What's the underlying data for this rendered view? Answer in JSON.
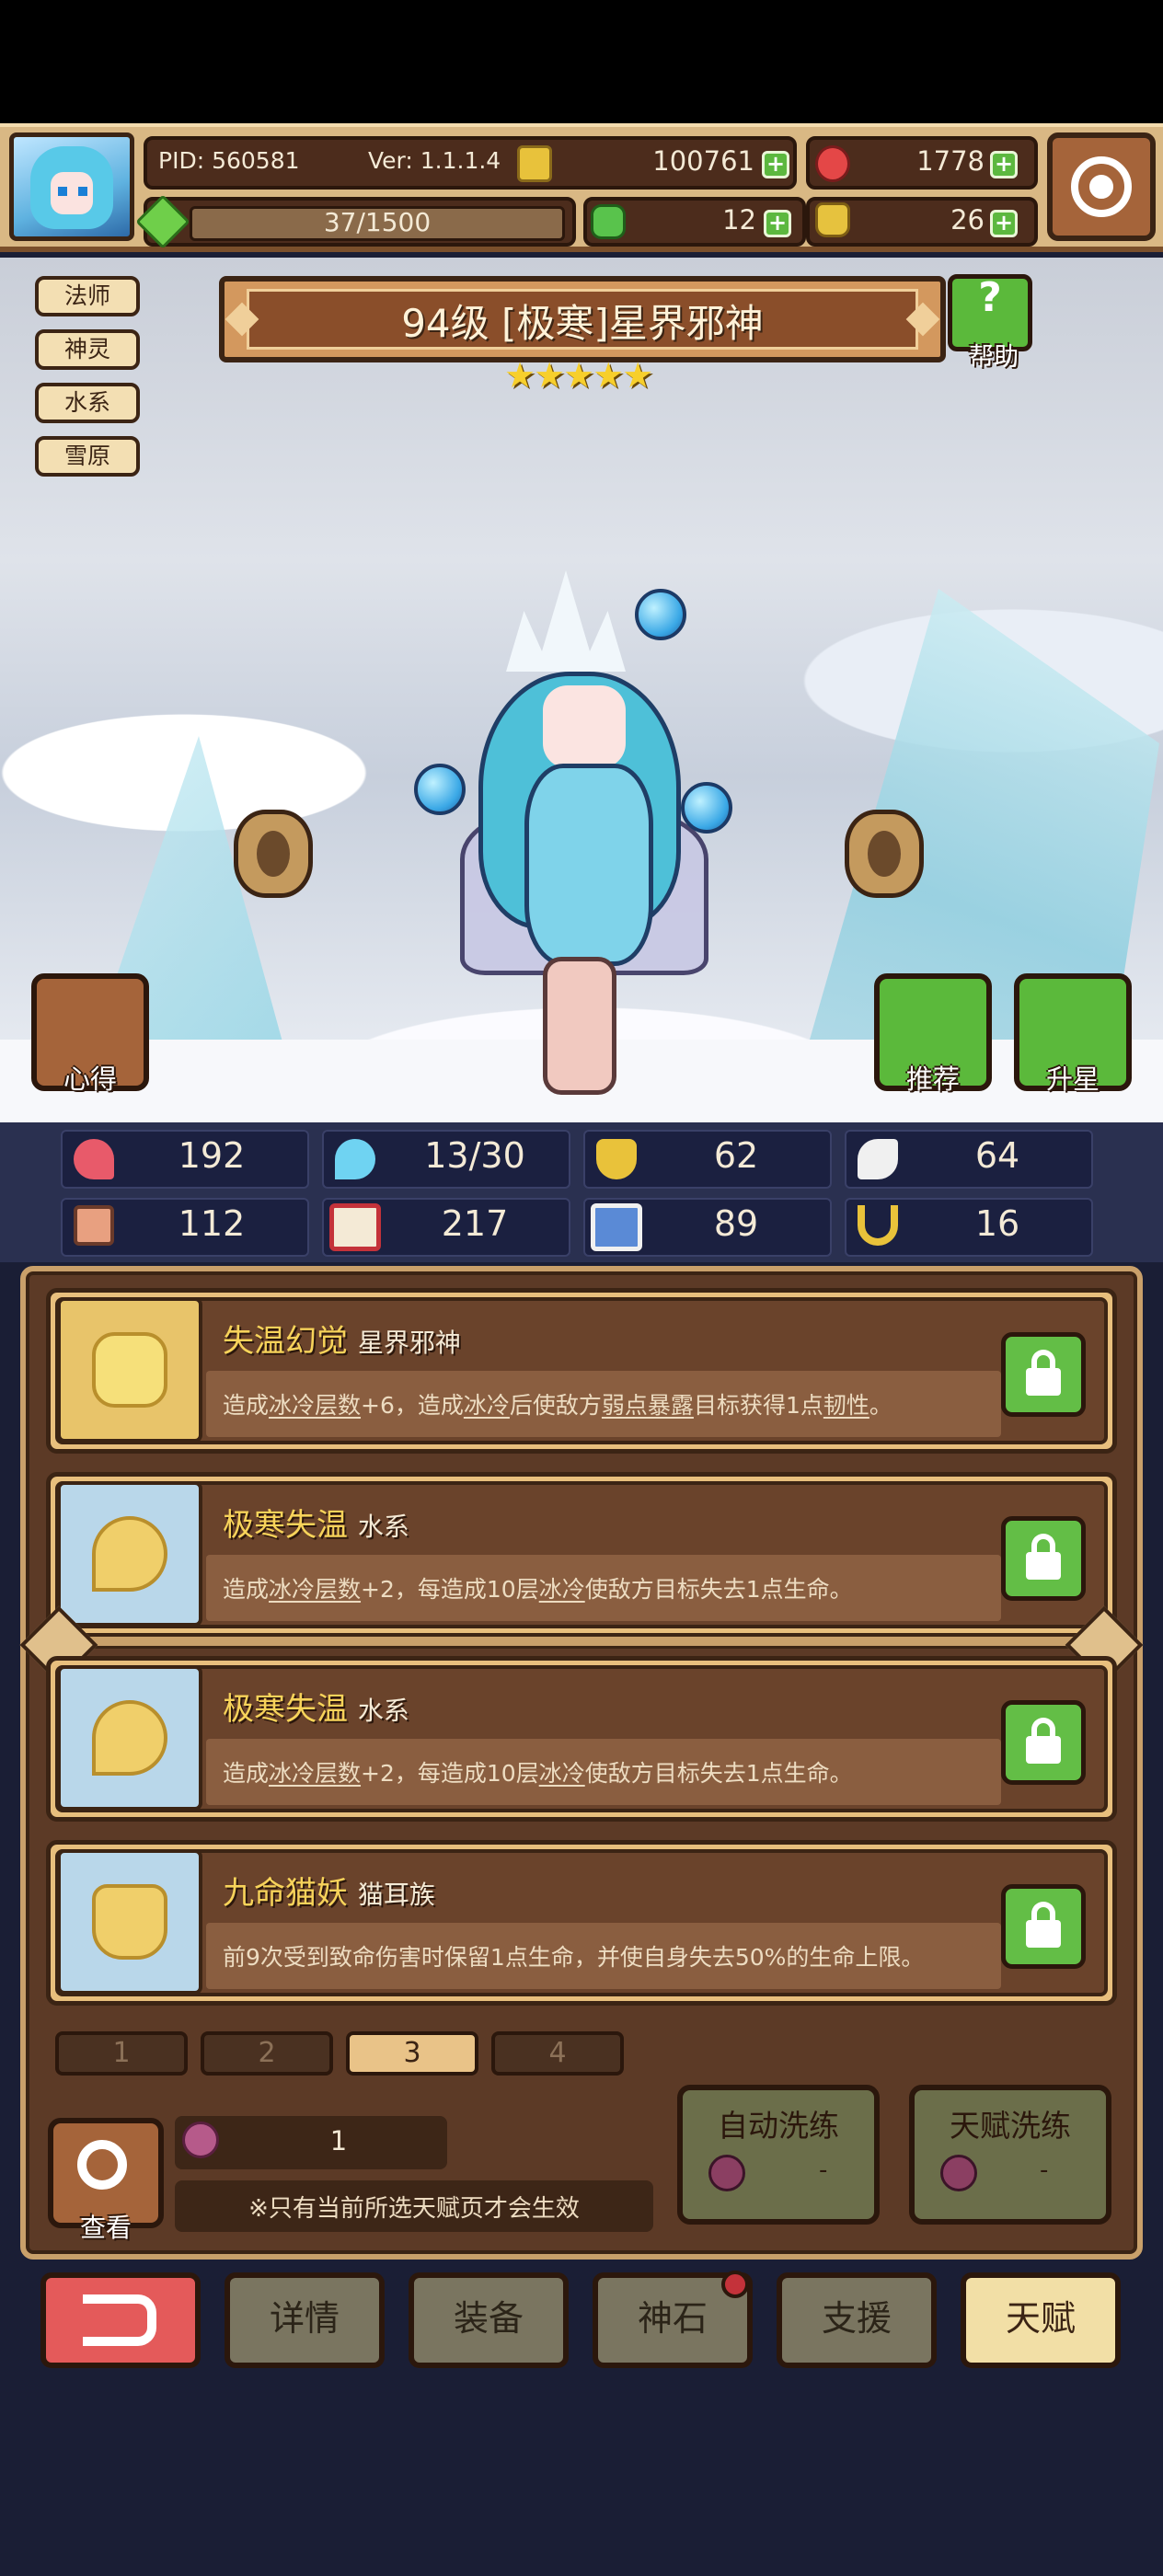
{
  "header": {
    "pid": "PID: 560581",
    "version": "Ver: 1.1.1.4",
    "gold": "100761",
    "gems": "1778",
    "energy": "37/1500",
    "clover": "12",
    "bag": "26"
  },
  "tags": [
    "法师",
    "神灵",
    "水系",
    "雪原"
  ],
  "hero": {
    "title": "94级 [极寒]星界邪神",
    "stars": "★★★★★",
    "star_count": 5,
    "help_label": "帮助"
  },
  "side_buttons": {
    "insight": "心得",
    "recommend": "推荐",
    "upgrade_star": "升星"
  },
  "stats": [
    {
      "name": "hp",
      "value": "192"
    },
    {
      "name": "mana",
      "value": "13/30"
    },
    {
      "name": "defense",
      "value": "62"
    },
    {
      "name": "speed",
      "value": "64"
    },
    {
      "name": "attack",
      "value": "112"
    },
    {
      "name": "magic",
      "value": "217"
    },
    {
      "name": "crit",
      "value": "89"
    },
    {
      "name": "luck",
      "value": "16"
    }
  ],
  "talents": [
    {
      "name": "失温幻觉",
      "type": "星界邪神",
      "desc_parts": [
        "造成",
        "冰冷层数",
        "+6，造成",
        "冰冷",
        "后使敌方",
        "弱点暴露",
        "目标获得1点",
        "韧性",
        "。"
      ]
    },
    {
      "name": "极寒失温",
      "type": "水系",
      "desc_parts": [
        "造成",
        "冰冷层数",
        "+2，每造成10层",
        "冰冷",
        "使敌方目标失去1点生命。"
      ]
    },
    {
      "name": "极寒失温",
      "type": "水系",
      "desc_parts": [
        "造成",
        "冰冷层数",
        "+2，每造成10层",
        "冰冷",
        "使敌方目标失去1点生命。"
      ]
    },
    {
      "name": "九命猫妖",
      "type": "猫耳族",
      "desc": "前9次受到致命伤害时保留1点生命，并使自身失去50%的生命上限。"
    }
  ],
  "pages": [
    "1",
    "2",
    "3",
    "4"
  ],
  "active_page": "3",
  "bottom": {
    "view_label": "查看",
    "fruit_count": "1",
    "note": "※只有当前所选天赋页才会生效",
    "auto_wash_label": "自动洗练",
    "auto_wash_value": "-",
    "talent_wash_label": "天赋洗练",
    "talent_wash_value": "-"
  },
  "nav": [
    "详情",
    "装备",
    "神石",
    "支援",
    "天赋"
  ],
  "colors": {
    "accent_gold": "#f7d35a",
    "panel_brown": "#5c3a26",
    "lock_green": "#63be46",
    "back_red": "#e45a5a"
  }
}
